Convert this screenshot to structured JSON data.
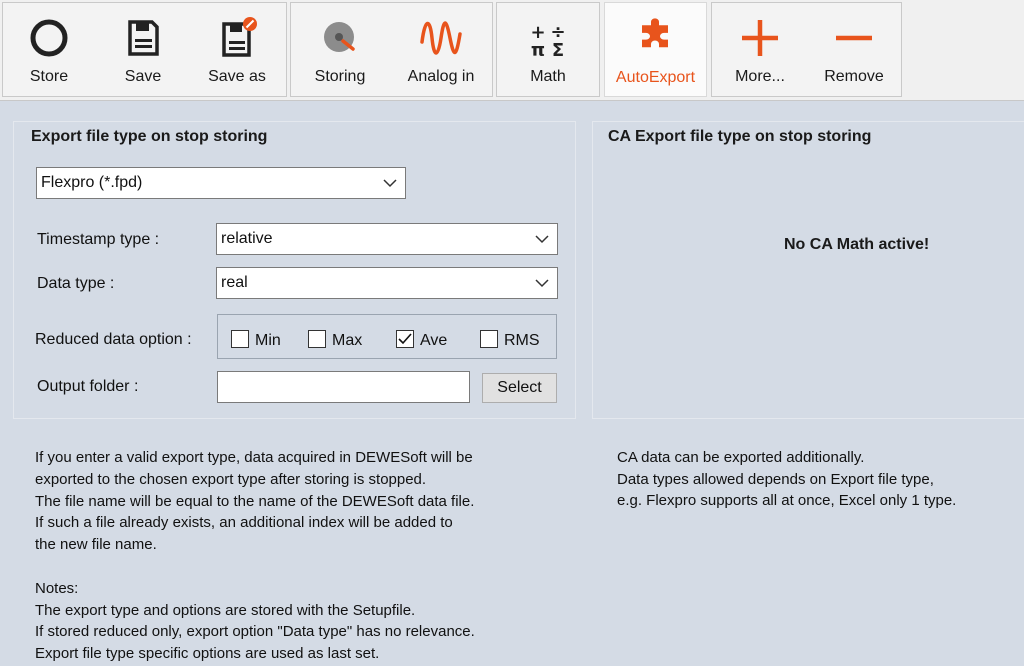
{
  "toolbar": {
    "store": "Store",
    "save": "Save",
    "save_as": "Save as",
    "storing": "Storing",
    "analog_in": "Analog in",
    "math": "Math",
    "autoexport": "AutoExport",
    "more": "More...",
    "remove": "Remove",
    "math_icon_symbols": [
      "+",
      "÷",
      "π",
      "Σ"
    ],
    "accent_color": "#e8541c"
  },
  "export_panel": {
    "heading": "Export file type on stop storing",
    "file_type_value": "Flexpro (*.fpd)",
    "timestamp_label": "Timestamp type :",
    "timestamp_value": "relative",
    "data_type_label": "Data type :",
    "data_type_value": "real",
    "reduced_label": "Reduced data option :",
    "reduced_options": [
      {
        "label": "Min",
        "checked": false
      },
      {
        "label": "Max",
        "checked": false
      },
      {
        "label": "Ave",
        "checked": true
      },
      {
        "label": "RMS",
        "checked": false
      }
    ],
    "output_folder_label": "Output folder :",
    "output_folder_value": "",
    "select_button": "Select"
  },
  "ca_panel": {
    "heading": "CA Export file type on stop storing",
    "message": "No CA Math active!"
  },
  "info_left": [
    "If you enter a valid export type, data acquired in DEWESoft will be",
    "exported to the chosen export type after storing is stopped.",
    "The file name will be equal to the name of the DEWESoft data file.",
    "If such a file already exists, an additional index will be added to",
    "the new file name.",
    "",
    "Notes:",
    "The export type and options are stored with the Setupfile.",
    "If stored reduced only, export option \"Data type\" has no relevance.",
    "Export file type specific options are used as last set."
  ],
  "info_right": [
    "CA data can be exported additionally.",
    "Data types allowed depends on Export file type,",
    "e.g. Flexpro supports all at once, Excel only 1 type."
  ]
}
